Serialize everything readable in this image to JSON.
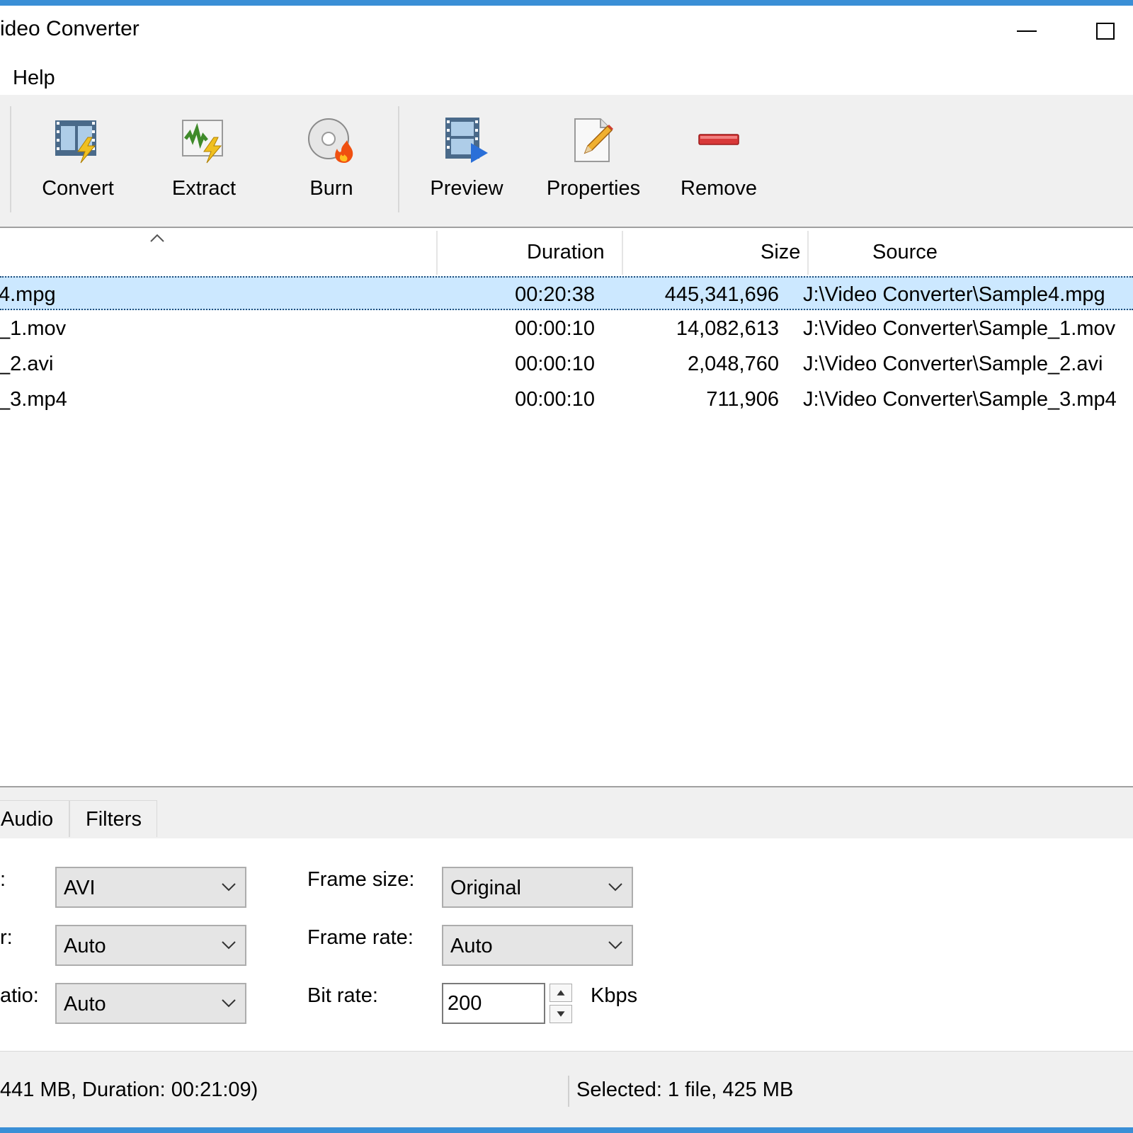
{
  "window": {
    "title": "Video Converter",
    "title_visible": "ideo Converter"
  },
  "menu": {
    "items": [
      {
        "label": "Help"
      }
    ]
  },
  "toolbar": {
    "buttons": [
      {
        "label": "Convert",
        "icon": "convert-icon"
      },
      {
        "label": "Extract",
        "icon": "extract-icon"
      },
      {
        "label": "Burn",
        "icon": "burn-icon"
      },
      {
        "label": "Preview",
        "icon": "preview-icon"
      },
      {
        "label": "Properties",
        "icon": "properties-icon"
      },
      {
        "label": "Remove",
        "icon": "remove-icon"
      }
    ]
  },
  "file_list": {
    "columns": {
      "duration": "Duration",
      "size": "Size",
      "source": "Source"
    },
    "rows": [
      {
        "name": "4.mpg",
        "duration": "00:20:38",
        "size": "445,341,696",
        "source": "J:\\Video Converter\\Sample4.mpg",
        "selected": true
      },
      {
        "name": "_1.mov",
        "duration": "00:00:10",
        "size": "14,082,613",
        "source": "J:\\Video Converter\\Sample_1.mov",
        "selected": false
      },
      {
        "name": "_2.avi",
        "duration": "00:00:10",
        "size": "2,048,760",
        "source": "J:\\Video Converter\\Sample_2.avi",
        "selected": false
      },
      {
        "name": "_3.mp4",
        "duration": "00:00:10",
        "size": "711,906",
        "source": "J:\\Video Converter\\Sample_3.mp4",
        "selected": false
      }
    ]
  },
  "panel": {
    "tabs": [
      {
        "label": "Audio"
      },
      {
        "label": "Filters"
      }
    ],
    "fields": {
      "format": {
        "label": ":",
        "value": "AVI"
      },
      "codec": {
        "label": "r:",
        "value": "Auto"
      },
      "aspect": {
        "label": "atio:",
        "value": "Auto"
      },
      "frame_size": {
        "label": "Frame size:",
        "value": "Original"
      },
      "frame_rate": {
        "label": "Frame rate:",
        "value": "Auto"
      },
      "bit_rate": {
        "label": "Bit rate:",
        "value": "200",
        "unit": "Kbps"
      }
    }
  },
  "status": {
    "left": "441 MB, Duration: 00:21:09)",
    "right": "Selected: 1 file, 425 MB"
  },
  "colors": {
    "accent": "#3a8fd6",
    "selection": "#cce8ff",
    "toolbar_bg": "#f0f0f0"
  }
}
